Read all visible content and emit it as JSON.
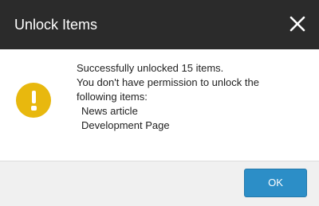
{
  "dialog": {
    "title": "Unlock Items",
    "close_icon": "close-icon",
    "status_icon": "warning-icon",
    "accent_color": "#e8b80e",
    "message": {
      "line1": "Successfully unlocked 15 items.",
      "line2": "You don't have permission to unlock the",
      "line3": "following items:",
      "items": [
        "News article",
        "Development Page"
      ]
    },
    "ok_label": "OK",
    "ok_color": "#2c8ec7"
  }
}
